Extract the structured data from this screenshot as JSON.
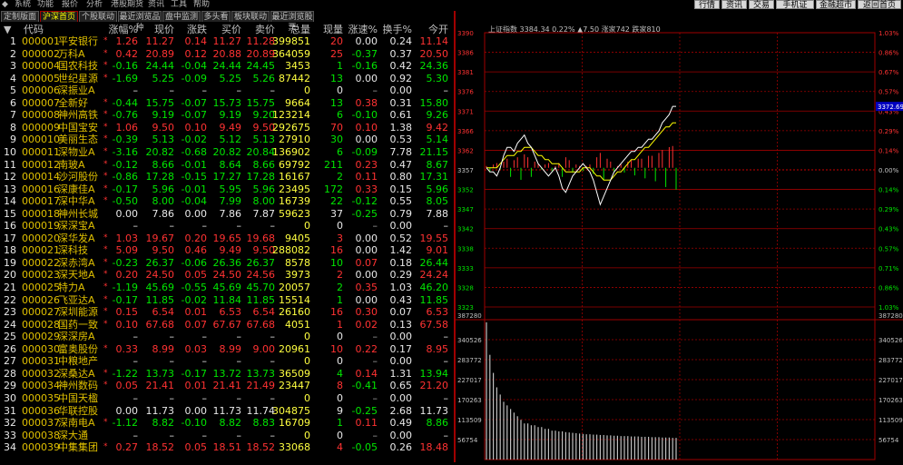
{
  "menu": [
    "系统",
    "功能",
    "报价",
    "分析",
    "港股期货",
    "资讯",
    "工具",
    "帮助"
  ],
  "top_buttons": [
    "行情",
    "资讯",
    "交易",
    "手机证券",
    "金融超市",
    "返回首页"
  ],
  "tabs": [
    "定制版面",
    "沪深首页",
    "个股联动",
    "最近浏览品种",
    "盘中监测",
    "多头看",
    "板块联动",
    "最近浏览股票"
  ],
  "columns": [
    "代码",
    "涨幅%",
    "现价",
    "涨跌",
    "买价",
    "卖价",
    "总量",
    "现量",
    "涨速%",
    "换手%",
    "今开"
  ],
  "rows": [
    {
      "n": "1",
      "code": "000001",
      "name": "平安银行",
      "pct": "1.26",
      "price": "11.27",
      "chg": "0.14",
      "bid": "11.27",
      "ask": "11.28",
      "vol": "399851",
      "cur": "20",
      "spd": "0.00",
      "turn": "0.24",
      "open": "11.14",
      "dir": "up"
    },
    {
      "n": "2",
      "code": "000002",
      "name": "万科A",
      "pct": "0.42",
      "price": "20.89",
      "chg": "0.12",
      "bid": "20.88",
      "ask": "20.89",
      "vol": "364059",
      "cur": "25",
      "spd": "-0.37",
      "turn": "0.37",
      "open": "20.50",
      "dir": "up"
    },
    {
      "n": "3",
      "code": "000004",
      "name": "国农科技",
      "pct": "-0.16",
      "price": "24.44",
      "chg": "-0.04",
      "bid": "24.44",
      "ask": "24.45",
      "vol": "3453",
      "cur": "1",
      "spd": "-0.16",
      "turn": "0.42",
      "open": "24.36",
      "dir": "down"
    },
    {
      "n": "4",
      "code": "000005",
      "name": "世纪星源",
      "pct": "-1.69",
      "price": "5.25",
      "chg": "-0.09",
      "bid": "5.25",
      "ask": "5.26",
      "vol": "87442",
      "cur": "13",
      "spd": "0.00",
      "turn": "0.92",
      "open": "5.30",
      "dir": "down"
    },
    {
      "n": "5",
      "code": "000006",
      "name": "深振业A",
      "pct": "–",
      "price": "–",
      "chg": "–",
      "bid": "–",
      "ask": "–",
      "vol": "0",
      "cur": "0",
      "spd": "–",
      "turn": "0.00",
      "open": "–",
      "dir": "none"
    },
    {
      "n": "6",
      "code": "000007",
      "name": "全新好",
      "pct": "-0.44",
      "price": "15.75",
      "chg": "-0.07",
      "bid": "15.73",
      "ask": "15.75",
      "vol": "9664",
      "cur": "13",
      "spd": "0.38",
      "turn": "0.31",
      "open": "15.80",
      "dir": "down"
    },
    {
      "n": "7",
      "code": "000008",
      "name": "神州高铁",
      "pct": "-0.76",
      "price": "9.19",
      "chg": "-0.07",
      "bid": "9.19",
      "ask": "9.20",
      "vol": "123214",
      "cur": "6",
      "spd": "-0.10",
      "turn": "0.61",
      "open": "9.26",
      "dir": "down"
    },
    {
      "n": "8",
      "code": "000009",
      "name": "中国宝安",
      "pct": "1.06",
      "price": "9.50",
      "chg": "0.10",
      "bid": "9.49",
      "ask": "9.50",
      "vol": "292675",
      "cur": "70",
      "spd": "0.10",
      "turn": "1.38",
      "open": "9.42",
      "dir": "up"
    },
    {
      "n": "9",
      "code": "000010",
      "name": "美丽生态",
      "pct": "-0.39",
      "price": "5.13",
      "chg": "-0.02",
      "bid": "5.12",
      "ask": "5.13",
      "vol": "27910",
      "cur": "30",
      "spd": "0.00",
      "turn": "0.53",
      "open": "5.14",
      "dir": "down"
    },
    {
      "n": "10",
      "code": "000011",
      "name": "深物业A",
      "pct": "-3.16",
      "price": "20.82",
      "chg": "-0.68",
      "bid": "20.82",
      "ask": "20.84",
      "vol": "136902",
      "cur": "6",
      "spd": "-0.09",
      "turn": "7.78",
      "open": "21.15",
      "dir": "down"
    },
    {
      "n": "11",
      "code": "000012",
      "name": "南玻A",
      "pct": "-0.12",
      "price": "8.66",
      "chg": "-0.01",
      "bid": "8.64",
      "ask": "8.66",
      "vol": "69792",
      "cur": "211",
      "spd": "0.23",
      "turn": "0.47",
      "open": "8.67",
      "dir": "down"
    },
    {
      "n": "12",
      "code": "000014",
      "name": "沙河股份",
      "pct": "-0.86",
      "price": "17.28",
      "chg": "-0.15",
      "bid": "17.27",
      "ask": "17.28",
      "vol": "16167",
      "cur": "2",
      "spd": "0.11",
      "turn": "0.80",
      "open": "17.31",
      "dir": "down"
    },
    {
      "n": "13",
      "code": "000016",
      "name": "深康佳A",
      "pct": "-0.17",
      "price": "5.96",
      "chg": "-0.01",
      "bid": "5.95",
      "ask": "5.96",
      "vol": "23495",
      "cur": "172",
      "spd": "0.33",
      "turn": "0.15",
      "open": "5.96",
      "dir": "down"
    },
    {
      "n": "14",
      "code": "000017",
      "name": "深中华A",
      "pct": "-0.50",
      "price": "8.00",
      "chg": "-0.04",
      "bid": "7.99",
      "ask": "8.00",
      "vol": "16739",
      "cur": "22",
      "spd": "-0.12",
      "turn": "0.55",
      "open": "8.05",
      "dir": "down"
    },
    {
      "n": "15",
      "code": "000018",
      "name": "神州长城",
      "pct": "0.00",
      "price": "7.86",
      "chg": "0.00",
      "bid": "7.86",
      "ask": "7.87",
      "vol": "59623",
      "cur": "37",
      "spd": "-0.25",
      "turn": "0.79",
      "open": "7.88",
      "dir": "flat"
    },
    {
      "n": "16",
      "code": "000019",
      "name": "深深宝A",
      "pct": "–",
      "price": "–",
      "chg": "–",
      "bid": "–",
      "ask": "–",
      "vol": "0",
      "cur": "0",
      "spd": "–",
      "turn": "0.00",
      "open": "–",
      "dir": "none"
    },
    {
      "n": "17",
      "code": "000020",
      "name": "深华发A",
      "pct": "1.03",
      "price": "19.67",
      "chg": "0.20",
      "bid": "19.65",
      "ask": "19.68",
      "vol": "9405",
      "cur": "3",
      "spd": "0.00",
      "turn": "0.52",
      "open": "19.55",
      "dir": "up"
    },
    {
      "n": "18",
      "code": "000021",
      "name": "深科技",
      "pct": "5.09",
      "price": "9.50",
      "chg": "0.46",
      "bid": "9.49",
      "ask": "9.50",
      "vol": "288082",
      "cur": "16",
      "spd": "0.00",
      "turn": "1.42",
      "open": "9.01",
      "dir": "up"
    },
    {
      "n": "19",
      "code": "000022",
      "name": "深赤湾A",
      "pct": "-0.23",
      "price": "26.37",
      "chg": "-0.06",
      "bid": "26.36",
      "ask": "26.37",
      "vol": "8578",
      "cur": "10",
      "spd": "0.07",
      "turn": "0.18",
      "open": "26.44",
      "dir": "down"
    },
    {
      "n": "20",
      "code": "000023",
      "name": "深天地A",
      "pct": "0.20",
      "price": "24.50",
      "chg": "0.05",
      "bid": "24.50",
      "ask": "24.56",
      "vol": "3973",
      "cur": "2",
      "spd": "0.00",
      "turn": "0.29",
      "open": "24.24",
      "dir": "up"
    },
    {
      "n": "21",
      "code": "000025",
      "name": "特力A",
      "pct": "-1.19",
      "price": "45.69",
      "chg": "-0.55",
      "bid": "45.69",
      "ask": "45.70",
      "vol": "20057",
      "cur": "2",
      "spd": "0.35",
      "turn": "1.03",
      "open": "46.20",
      "dir": "down"
    },
    {
      "n": "22",
      "code": "000026",
      "name": "飞亚达A",
      "pct": "-0.17",
      "price": "11.85",
      "chg": "-0.02",
      "bid": "11.84",
      "ask": "11.85",
      "vol": "15514",
      "cur": "1",
      "spd": "0.00",
      "turn": "0.43",
      "open": "11.85",
      "dir": "down"
    },
    {
      "n": "23",
      "code": "000027",
      "name": "深圳能源",
      "pct": "0.15",
      "price": "6.54",
      "chg": "0.01",
      "bid": "6.53",
      "ask": "6.54",
      "vol": "26160",
      "cur": "16",
      "spd": "0.30",
      "turn": "0.07",
      "open": "6.53",
      "dir": "up"
    },
    {
      "n": "24",
      "code": "000028",
      "name": "国药一致",
      "pct": "0.10",
      "price": "67.68",
      "chg": "0.07",
      "bid": "67.67",
      "ask": "67.68",
      "vol": "4051",
      "cur": "1",
      "spd": "0.02",
      "turn": "0.13",
      "open": "67.58",
      "dir": "up"
    },
    {
      "n": "25",
      "code": "000029",
      "name": "深深房A",
      "pct": "–",
      "price": "–",
      "chg": "–",
      "bid": "–",
      "ask": "–",
      "vol": "0",
      "cur": "0",
      "spd": "–",
      "turn": "0.00",
      "open": "–",
      "dir": "none"
    },
    {
      "n": "26",
      "code": "000030",
      "name": "富奥股份",
      "pct": "0.33",
      "price": "8.99",
      "chg": "0.03",
      "bid": "8.99",
      "ask": "9.00",
      "vol": "20961",
      "cur": "10",
      "spd": "0.22",
      "turn": "0.17",
      "open": "8.95",
      "dir": "up"
    },
    {
      "n": "27",
      "code": "000031",
      "name": "中粮地产",
      "pct": "–",
      "price": "–",
      "chg": "–",
      "bid": "–",
      "ask": "–",
      "vol": "0",
      "cur": "0",
      "spd": "–",
      "turn": "0.00",
      "open": "–",
      "dir": "none"
    },
    {
      "n": "28",
      "code": "000032",
      "name": "深桑达A",
      "pct": "-1.22",
      "price": "13.73",
      "chg": "-0.17",
      "bid": "13.72",
      "ask": "13.73",
      "vol": "36509",
      "cur": "4",
      "spd": "0.14",
      "turn": "1.31",
      "open": "13.94",
      "dir": "down"
    },
    {
      "n": "29",
      "code": "000034",
      "name": "神州数码",
      "pct": "0.05",
      "price": "21.41",
      "chg": "0.01",
      "bid": "21.41",
      "ask": "21.49",
      "vol": "23447",
      "cur": "8",
      "spd": "-0.41",
      "turn": "0.65",
      "open": "21.20",
      "dir": "up"
    },
    {
      "n": "30",
      "code": "000035",
      "name": "中国天楹",
      "pct": "–",
      "price": "–",
      "chg": "–",
      "bid": "–",
      "ask": "–",
      "vol": "0",
      "cur": "0",
      "spd": "–",
      "turn": "0.00",
      "open": "–",
      "dir": "none"
    },
    {
      "n": "31",
      "code": "000036",
      "name": "华联控股",
      "pct": "0.00",
      "price": "11.73",
      "chg": "0.00",
      "bid": "11.73",
      "ask": "11.74",
      "vol": "304875",
      "cur": "9",
      "spd": "-0.25",
      "turn": "2.68",
      "open": "11.73",
      "dir": "flat"
    },
    {
      "n": "32",
      "code": "000037",
      "name": "深南电A",
      "pct": "-1.12",
      "price": "8.82",
      "chg": "-0.10",
      "bid": "8.82",
      "ask": "8.83",
      "vol": "16709",
      "cur": "1",
      "spd": "0.11",
      "turn": "0.49",
      "open": "8.86",
      "dir": "down"
    },
    {
      "n": "33",
      "code": "000038",
      "name": "深大通",
      "pct": "–",
      "price": "–",
      "chg": "–",
      "bid": "–",
      "ask": "–",
      "vol": "0",
      "cur": "0",
      "spd": "–",
      "turn": "0.00",
      "open": "–",
      "dir": "none"
    },
    {
      "n": "34",
      "code": "000039",
      "name": "中集集团",
      "pct": "0.27",
      "price": "18.52",
      "chg": "0.05",
      "bid": "18.51",
      "ask": "18.52",
      "vol": "33068",
      "cur": "4",
      "spd": "-0.05",
      "turn": "0.26",
      "open": "18.48",
      "dir": "up"
    }
  ],
  "chart": {
    "header_text": "上证指数  3384.34  0.22%  ▲7.50  涨家742  跌家810",
    "price_ticks": [
      "3390",
      "3386",
      "3381",
      "3376",
      "3371",
      "3366",
      "3362",
      "3357",
      "3352",
      "3347",
      "3342",
      "3338",
      "3333",
      "3328",
      "3323"
    ],
    "pct_ticks": [
      "1.03%",
      "0.86%",
      "0.67%",
      "0.57%",
      "0.43%",
      "0.29%",
      "0.14%",
      "0.00%",
      "0.14%",
      "0.29%",
      "0.43%",
      "0.57%",
      "0.71%",
      "0.86%",
      "1.03%"
    ],
    "current_price_tag": "3372.69",
    "vol_ticks": [
      "387280",
      "340526",
      "283772",
      "227017",
      "170263",
      "113509",
      "56754"
    ],
    "colors": {
      "up": "#ff3232",
      "down": "#00e600",
      "grid": "#a00000",
      "price_line": "#ffffff",
      "avg_line": "#ffff00"
    }
  },
  "chart_data": {
    "type": "line",
    "title": "上证指数",
    "ylim": [
      3323,
      3390
    ],
    "series": [
      {
        "name": "",
        "values": [
          3357,
          3356,
          3356,
          3355,
          3357,
          3360,
          3362,
          3362,
          3361,
          3363,
          3364,
          3365,
          3363,
          3362,
          3360,
          3358,
          3357,
          3356,
          3355,
          3356,
          3357,
          3355,
          3352,
          3351,
          3353,
          3355,
          3356,
          3357,
          3358,
          3357,
          3356,
          3354,
          3351,
          3348,
          3350,
          3352,
          3354,
          3356,
          3357,
          3358,
          3359,
          3360,
          3361,
          3361,
          3362,
          3362,
          3363,
          3364,
          3364,
          3365,
          3366,
          3368,
          3369,
          3370,
          3372,
          3372
        ]
      },
      {
        "name": "",
        "values": [
          3357,
          3357,
          3357,
          3357,
          3358,
          3359,
          3360,
          3360,
          3360,
          3361,
          3361,
          3362,
          3362,
          3362,
          3361,
          3360,
          3360,
          3359,
          3359,
          3358,
          3358,
          3358,
          3357,
          3356,
          3356,
          3356,
          3356,
          3356,
          3357,
          3357,
          3357,
          3356,
          3355,
          3355,
          3354,
          3354,
          3354,
          3355,
          3356,
          3356,
          3357,
          3358,
          3359,
          3359,
          3360,
          3361,
          3362,
          3362,
          3363,
          3364,
          3365,
          3366,
          3367,
          3367,
          3368,
          3368
        ]
      }
    ],
    "volume": [
      380000,
      290000,
      240000,
      200000,
      180000,
      160000,
      150000,
      140000,
      130000,
      120000,
      110000,
      100000,
      100000,
      95000,
      95000,
      90000,
      90000,
      85000,
      85000,
      80000,
      80000,
      78000,
      78000,
      76000,
      75000,
      74000,
      73000,
      72000,
      71000,
      70000,
      70000,
      69000,
      69000,
      68000,
      68000,
      67000,
      67000,
      66000,
      66000,
      65000,
      65000,
      65000,
      64000,
      64000,
      64000,
      63000,
      63000,
      63000,
      62000,
      62000,
      62000,
      61000,
      61000,
      61000,
      60000,
      60000
    ]
  }
}
